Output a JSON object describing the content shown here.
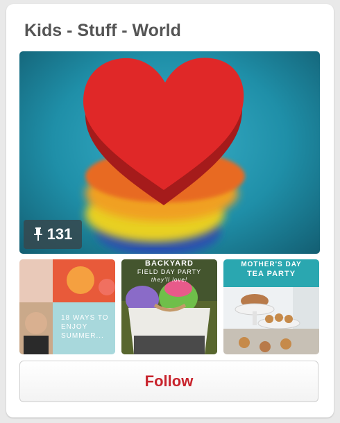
{
  "board": {
    "title": "Kids - Stuff - World",
    "pin_count": "131",
    "pin_icon": "pin-icon"
  },
  "thumbnails": [
    {
      "text": "18 WAYS TO ENJOY SUMMER..."
    },
    {
      "text_line1": "BACKYARD",
      "text_line2": "FIELD DAY PARTY",
      "text_line3": "they'll love!"
    },
    {
      "text_line1": "MOTHER'S DAY",
      "text_line2": "TEA PARTY"
    }
  ],
  "follow_button": {
    "label": "Follow"
  },
  "colors": {
    "accent": "#c8232c",
    "title": "#555555",
    "badge": "#36484e"
  }
}
